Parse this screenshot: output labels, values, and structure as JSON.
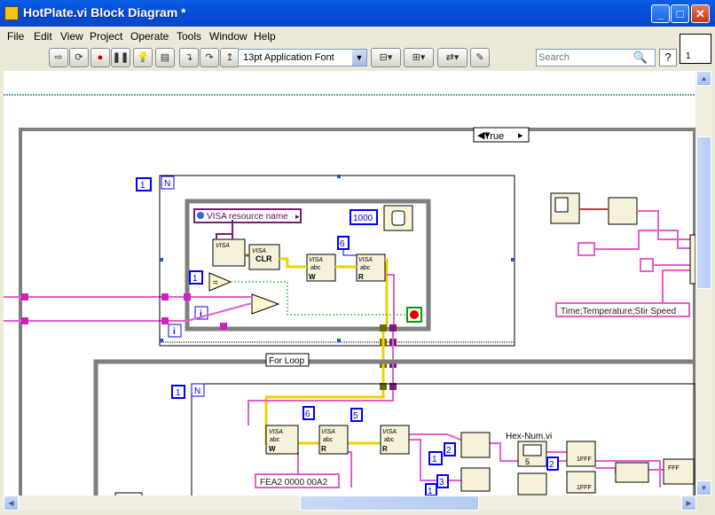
{
  "window": {
    "title": "HotPlate.vi Block Diagram *"
  },
  "menu": [
    "File",
    "Edit",
    "View",
    "Project",
    "Operate",
    "Tools",
    "Window",
    "Help"
  ],
  "toolbar": {
    "font_selector": "13pt Application Font",
    "search_placeholder": "Search",
    "help_label": "?",
    "connector_number": "1"
  },
  "diagram": {
    "case_selector": "True",
    "inner_while_count": "N",
    "visa_resource_name": "VISA resource name",
    "visa_label": "VISA",
    "clr_label": "CLR",
    "abc_label": "abc",
    "w_label": "W",
    "r_label": "R",
    "wait_ms": "1000",
    "num_1": "1",
    "num_2": "2",
    "num_3": "3",
    "num_5": "5",
    "num_6": "6",
    "iter_label": "i",
    "for_loop_label": "For Loop",
    "header_string": "Time;Temperature;Stir Speed",
    "hex_label": "Hex-Num.vi",
    "hex_string": "FEA2 0000 00A2",
    "fff_label": "1FFF"
  },
  "colors": {
    "titlebar": "#0a5ee6",
    "wire_string": "#e65dd1",
    "wire_integer": "#0000ff",
    "wire_boolean": "#00a000",
    "wire_visa": "#8a6b00",
    "structure_border": "#808080"
  },
  "icons": [
    "labview-app-icon",
    "run-arrow-icon",
    "run-continuous-icon",
    "abort-icon",
    "pause-icon",
    "highlight-execution-icon",
    "retain-wire-values-icon",
    "step-into-icon",
    "step-over-icon",
    "step-out-icon",
    "align-objects-icon",
    "distribute-objects-icon",
    "reorder-icon",
    "cleanup-diagram-icon",
    "search-icon",
    "help-icon"
  ]
}
